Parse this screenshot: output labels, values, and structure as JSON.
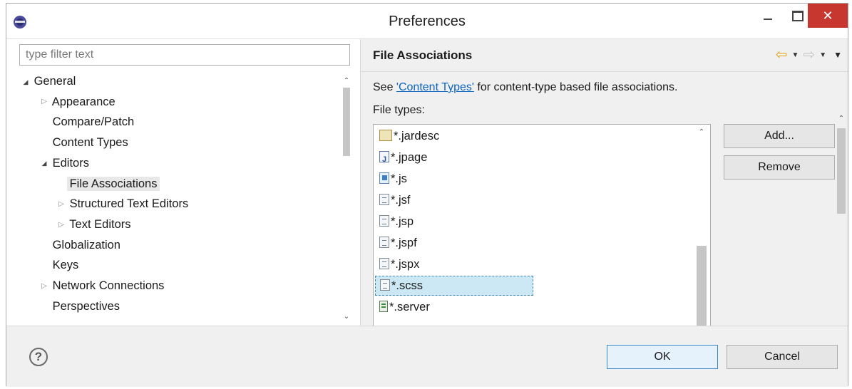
{
  "window": {
    "title": "Preferences"
  },
  "titlebar": {
    "minimize": "",
    "maximize": "",
    "close": "✕"
  },
  "filter": {
    "placeholder": "type filter text",
    "value": ""
  },
  "tree": {
    "items": [
      {
        "label": "General",
        "level": 0,
        "toggle": "expanded"
      },
      {
        "label": "Appearance",
        "level": 1,
        "toggle": "collapsed"
      },
      {
        "label": "Compare/Patch",
        "level": 1,
        "toggle": "none"
      },
      {
        "label": "Content Types",
        "level": 1,
        "toggle": "none"
      },
      {
        "label": "Editors",
        "level": 1,
        "toggle": "expanded"
      },
      {
        "label": "File Associations",
        "level": 2,
        "toggle": "none",
        "selected": true
      },
      {
        "label": "Structured Text Editors",
        "level": 2,
        "toggle": "collapsed"
      },
      {
        "label": "Text Editors",
        "level": 2,
        "toggle": "collapsed"
      },
      {
        "label": "Globalization",
        "level": 1,
        "toggle": "none"
      },
      {
        "label": "Keys",
        "level": 1,
        "toggle": "none"
      },
      {
        "label": "Network Connections",
        "level": 1,
        "toggle": "collapsed"
      },
      {
        "label": "Perspectives",
        "level": 1,
        "toggle": "none"
      }
    ]
  },
  "page": {
    "title": "File Associations",
    "see_prefix": "See ",
    "see_link": "'Content Types'",
    "see_suffix": " for content-type based file associations.",
    "file_types_label": "File types:",
    "file_types": [
      {
        "name": "*.jardesc",
        "icon": "jar-file-icon"
      },
      {
        "name": "*.jpage",
        "icon": "java-page-file-icon"
      },
      {
        "name": "*.js",
        "icon": "javascript-file-icon"
      },
      {
        "name": "*.jsf",
        "icon": "text-file-icon"
      },
      {
        "name": "*.jsp",
        "icon": "text-file-icon"
      },
      {
        "name": "*.jspf",
        "icon": "text-file-icon"
      },
      {
        "name": "*.jspx",
        "icon": "text-file-icon"
      },
      {
        "name": "*.scss",
        "icon": "text-file-icon",
        "selected": true
      },
      {
        "name": "*.server",
        "icon": "server-file-icon"
      }
    ],
    "add_label": "Add...",
    "remove_label": "Remove"
  },
  "footer": {
    "ok_label": "OK",
    "cancel_label": "Cancel",
    "help": "?"
  }
}
